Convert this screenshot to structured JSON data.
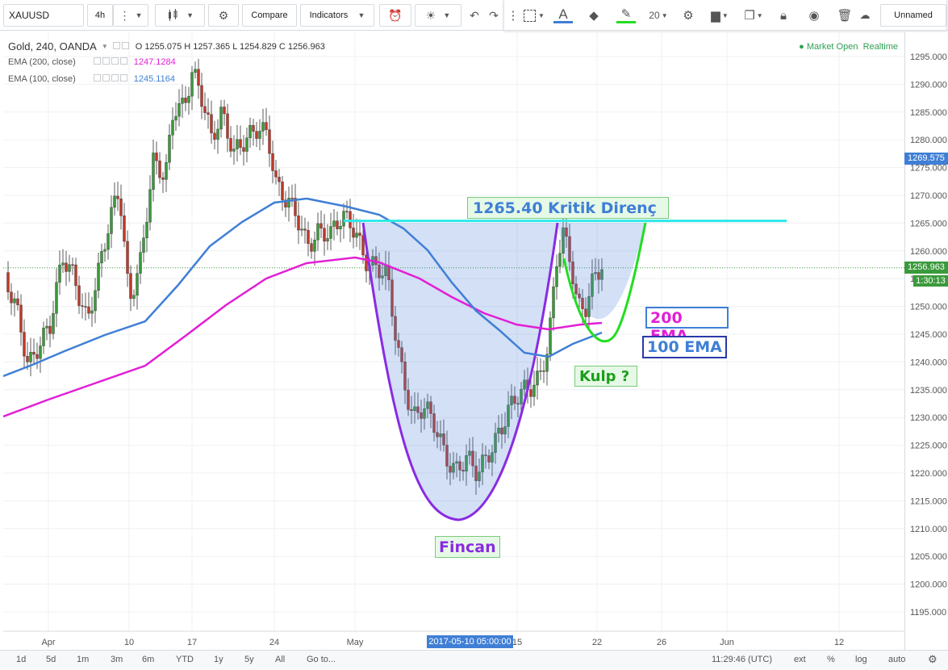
{
  "toolbar": {
    "symbol": "XAUUSD",
    "interval": "4h",
    "compare_label": "Compare",
    "indicators_label": "Indicators",
    "font_size": "20",
    "layout_name": "Unnamed"
  },
  "legend": {
    "main_title": "Gold, 240, OANDA",
    "ohlc_text": "O 1255.075 H 1257.365 L 1254.829 C 1256.963",
    "ema200_label": "EMA (200, close)",
    "ema200_value": "1247.1284",
    "ema100_label": "EMA (100, close)",
    "ema100_value": "1245.1164"
  },
  "status": {
    "market": "Market Open",
    "realtime": "Realtime"
  },
  "price_axis": {
    "ticks": [
      "1295.000",
      "1290.000",
      "1285.000",
      "1280.000",
      "1275.000",
      "1270.000",
      "1265.000",
      "1260.000",
      "1255.000",
      "1250.000",
      "1245.000",
      "1240.000",
      "1235.000",
      "1230.000",
      "1225.000",
      "1220.000",
      "1215.000",
      "1210.000",
      "1205.000",
      "1200.000",
      "1195.000"
    ],
    "badge_high": "1269.575",
    "badge_last": "1256.963",
    "countdown": "1:30:13"
  },
  "time_axis": {
    "labels": [
      "Apr",
      "10",
      "17",
      "24",
      "May",
      "15",
      "22",
      "26",
      "Jun",
      "12"
    ],
    "crosshair_label": "2017-05-10 05:00:00"
  },
  "annotations": {
    "resistance": "1265.40 Kritik Direnç",
    "ema200": "200 EMA",
    "ema100": "100 EMA",
    "handle": "Kulp ?",
    "cup": "Fincan"
  },
  "bottom": {
    "ranges": [
      "1d",
      "5d",
      "1m",
      "3m",
      "6m",
      "YTD",
      "1y",
      "5y",
      "All"
    ],
    "goto": "Go to...",
    "clock": "11:29:46 (UTC)",
    "ext": "ext",
    "percent": "%",
    "log": "log",
    "auto": "auto"
  },
  "colors": {
    "ema200": "#e21fd6",
    "ema100": "#3f7fd6",
    "cup": "#8a2be2",
    "handle": "#22dd22",
    "resistance": "#2ee8e8",
    "up": "#3b9a3b",
    "down": "#c0392b"
  },
  "chart_data": {
    "type": "candlestick",
    "symbol": "Gold",
    "interval": "240",
    "price_range": [
      1192,
      1298
    ],
    "resistance_level": 1265.4,
    "last_price": 1256.963
  }
}
